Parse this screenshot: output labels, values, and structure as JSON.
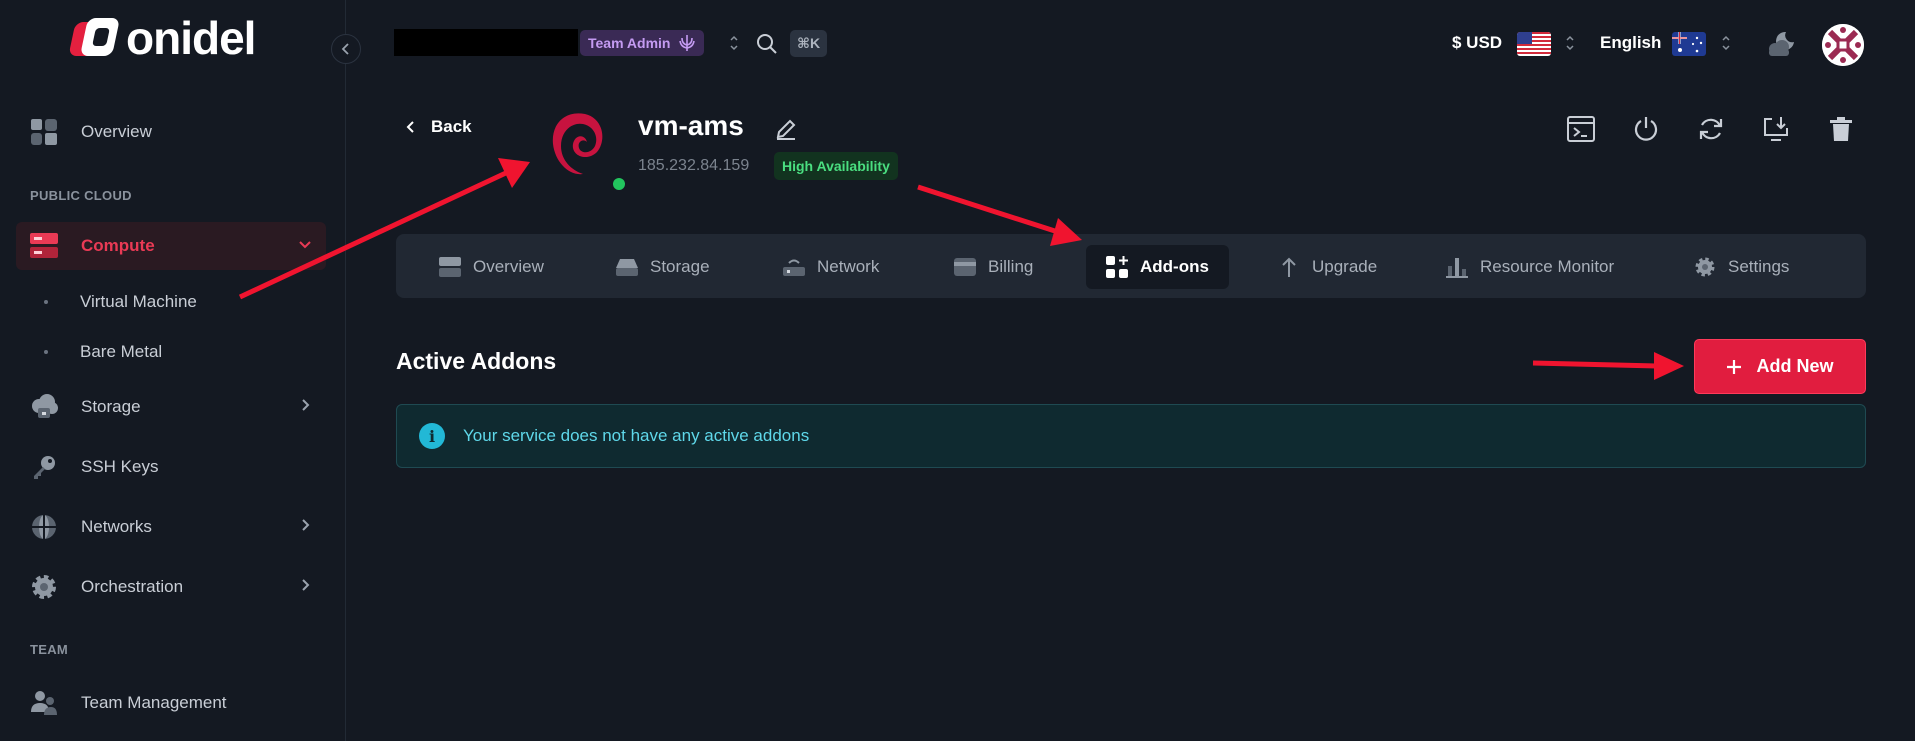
{
  "brand": {
    "name": "onidel"
  },
  "sidebar": {
    "overview": "Overview",
    "section_public_cloud": "PUBLIC CLOUD",
    "compute": "Compute",
    "compute_children": [
      "Virtual Machine",
      "Bare Metal"
    ],
    "storage": "Storage",
    "ssh_keys": "SSH Keys",
    "networks": "Networks",
    "orchestration": "Orchestration",
    "section_team": "TEAM",
    "team_management": "Team Management"
  },
  "topbar": {
    "team_role": "Team Admin",
    "shortcut": "⌘K",
    "currency": "$ USD",
    "language": "English"
  },
  "vm": {
    "back_label": "Back",
    "name": "vm-ams",
    "ip": "185.232.84.159",
    "badge": "High Availability",
    "status_color": "#22c55e"
  },
  "tabs": [
    "Overview",
    "Storage",
    "Network",
    "Billing",
    "Add-ons",
    "Upgrade",
    "Resource Monitor",
    "Settings"
  ],
  "active_tab": "Add-ons",
  "addons": {
    "title": "Active Addons",
    "add_button": "Add New",
    "empty_message": "Your service does not have any active addons"
  },
  "colors": {
    "accent": "#e11d3f",
    "info": "#22b8d6",
    "annotation": "#f0142f"
  }
}
